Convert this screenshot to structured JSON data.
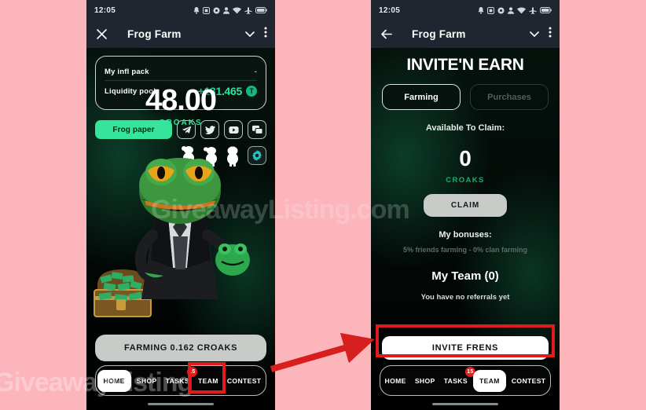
{
  "page": {
    "background_color": "#fbb5bb",
    "watermark_center": "GiveawayListing.com",
    "watermark_bottom": "GiveawayListing"
  },
  "annotation": {
    "color": "#e01b1b",
    "arrow_from": "team-nav-button-left-phone",
    "arrow_to": "invite-frens-button-right-phone"
  },
  "status_bar": {
    "time": "12:05",
    "icons": [
      "bell-icon",
      "image-icon",
      "gear-icon",
      "person-icon",
      "wifi-icon",
      "airplane-icon",
      "battery-icon"
    ]
  },
  "title_bar": {
    "title": "Frog Farm",
    "left_icon_home": "close-icon",
    "left_icon_team": "back-arrow-icon",
    "right_icons": [
      "chevron-down-icon",
      "more-vertical-icon"
    ]
  },
  "home_screen": {
    "stats": [
      {
        "label": "My infl pack",
        "value": "-",
        "accent": false
      },
      {
        "label": "Liquidity pool",
        "value": "+131.465",
        "accent": true,
        "coin": "T"
      }
    ],
    "frog_paper_label": "Frog paper",
    "social_icons": [
      "telegram-icon",
      "twitter-icon",
      "youtube-icon",
      "chat-icon"
    ],
    "settings_icon": "gear-icon",
    "balance": "48.00",
    "balance_unit": "CROAKS",
    "farming_button": "FARMING 0.162 CROAKS",
    "accent_green": "#37e59a",
    "accent_mint": "#2ee6a0"
  },
  "team_screen": {
    "heading": "INVITE'N EARN",
    "tabs": [
      {
        "label": "Farming",
        "active": true
      },
      {
        "label": "Purchases",
        "active": false
      }
    ],
    "claim_label": "Available To Claim:",
    "claim_amount": "0",
    "claim_unit": "CROAKS",
    "claim_button": "CLAIM",
    "bonuses_title": "My bonuses:",
    "bonuses_detail": "5% friends farming - 0% clan farming",
    "team_title": "My Team (0)",
    "team_empty": "You have no referrals yet",
    "invite_button": "INVITE FRENS"
  },
  "bottom_nav": {
    "items_home": [
      {
        "label": "HOME",
        "active": true,
        "badge": null
      },
      {
        "label": "SHOP",
        "active": false,
        "badge": null
      },
      {
        "label": "TASKS",
        "active": false,
        "badge": "15"
      },
      {
        "label": "TEAM",
        "active": false,
        "badge": null
      },
      {
        "label": "CONTEST",
        "active": false,
        "badge": null
      }
    ],
    "items_team": [
      {
        "label": "HOME",
        "active": false,
        "badge": null
      },
      {
        "label": "SHOP",
        "active": false,
        "badge": null
      },
      {
        "label": "TASKS",
        "active": false,
        "badge": "15"
      },
      {
        "label": "TEAM",
        "active": true,
        "badge": null
      },
      {
        "label": "CONTEST",
        "active": false,
        "badge": null
      }
    ]
  }
}
